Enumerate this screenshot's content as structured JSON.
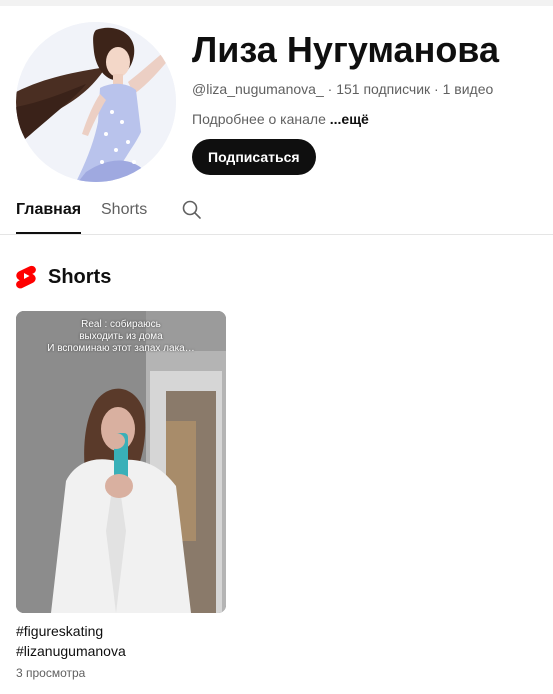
{
  "channel": {
    "name": "Лиза Нугуманова",
    "handle": "@liza_nugumanova_",
    "subscribers": "151 подписчик",
    "videos": "1 видео",
    "separator": " · ",
    "description": "Подробнее о канале ",
    "more_label": "...ещё",
    "subscribe_label": "Подписаться",
    "avatar_icon": "avatar-figure-skater-illustration"
  },
  "tabs": [
    {
      "label": "Главная",
      "active": true
    },
    {
      "label": "Shorts",
      "active": false
    }
  ],
  "search_icon": "search-icon",
  "shorts_section": {
    "title": "Shorts",
    "logo_icon": "shorts-logo-icon",
    "logo_color": "#ff0000",
    "items": [
      {
        "overlay_lines": [
          "Real : собираюсь",
          "выходить из  дома",
          "И вспоминаю этот запах лака…"
        ],
        "title_lines": [
          "#figureskating",
          "#lizanugumanova"
        ],
        "views": "3 просмотра"
      }
    ]
  },
  "colors": {
    "text_primary": "#0f0f0f",
    "text_secondary": "#606060",
    "button_bg": "#0f0f0f",
    "button_text": "#ffffff"
  }
}
